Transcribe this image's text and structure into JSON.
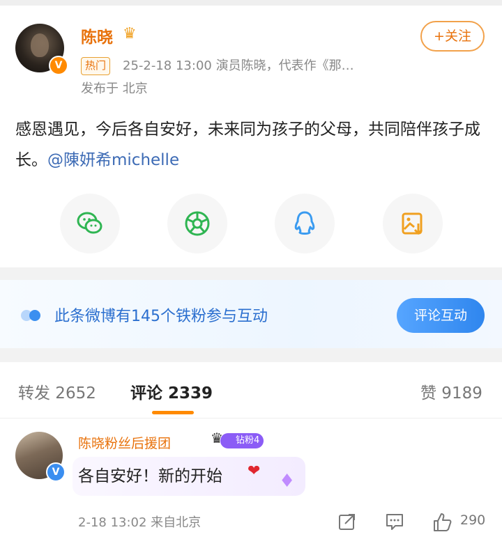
{
  "post": {
    "author": "陈晓",
    "follow_label": "+关注",
    "hot_tag": "热门",
    "meta": "25-2-18 13:00  演员陈晓，代表作《那…",
    "location": "发布于 北京",
    "text_main": "感恩遇见，今后各自安好，未来同为孩子的父母，共同陪伴孩子成长。",
    "mention": "@陳妍希michelle",
    "share_icons": [
      "wechat-icon",
      "moments-icon",
      "qq-icon",
      "save-image-icon"
    ]
  },
  "fans_banner": {
    "text": "此条微博有145个铁粉参与互动",
    "button": "评论互动"
  },
  "tabs": {
    "repost": "转发 2652",
    "comments": "评论 2339",
    "likes": "赞 9189"
  },
  "comment": {
    "author": "陈晓粉丝后援团",
    "badge": "钻粉4",
    "text": "各自安好！新的开始",
    "time": "2-18 13:02  来自北京",
    "like_count": "290"
  },
  "colors": {
    "accent_orange": "#e8720c",
    "link_blue": "#3d6bb5",
    "banner_blue": "#2f86ee"
  }
}
